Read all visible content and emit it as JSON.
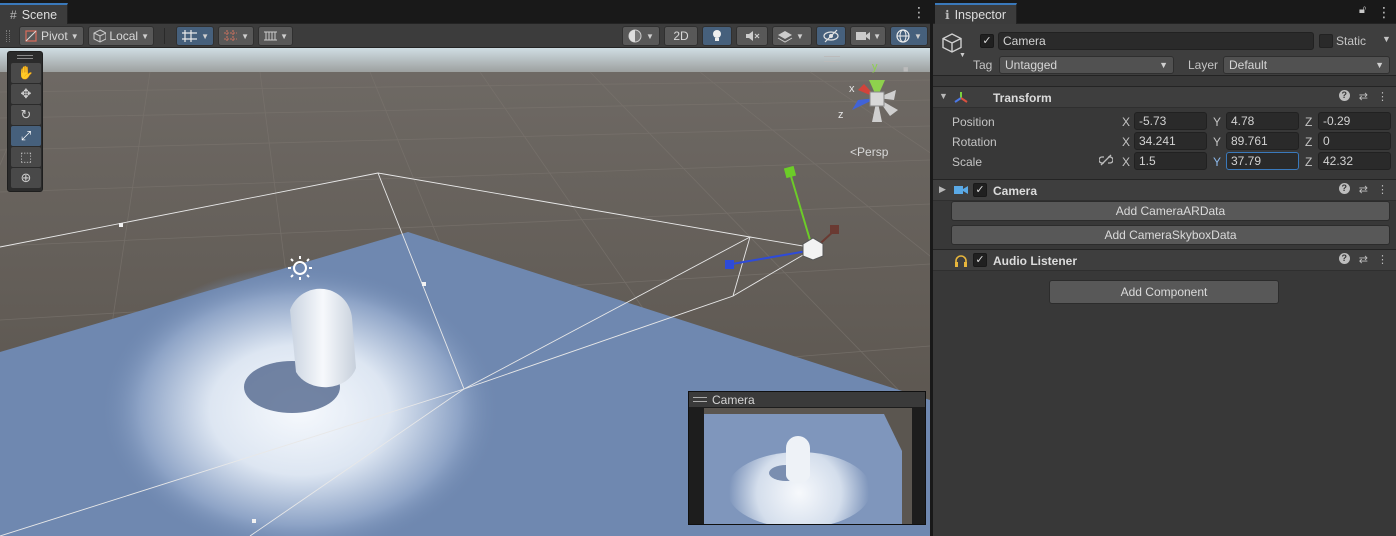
{
  "scene": {
    "tab_title": "Scene",
    "toolbar": {
      "pivot_label": "Pivot",
      "local_label": "Local",
      "mode_2d_label": "2D"
    },
    "persp_label": "Persp",
    "gizmo_axes": {
      "x": "x",
      "y": "y",
      "z": "z"
    },
    "tools": [
      "hand-tool",
      "move-tool",
      "rotate-tool",
      "scale-tool",
      "rect-tool",
      "transform-tool"
    ],
    "active_tool": "scale-tool",
    "camera_preview_title": "Camera"
  },
  "inspector": {
    "tab_title": "Inspector",
    "object": {
      "active": true,
      "name": "Camera",
      "static_label": "Static",
      "tag_label": "Tag",
      "tag_value": "Untagged",
      "layer_label": "Layer",
      "layer_value": "Default"
    },
    "transform": {
      "title": "Transform",
      "position_label": "Position",
      "rotation_label": "Rotation",
      "scale_label": "Scale",
      "axis_x": "X",
      "axis_y": "Y",
      "axis_z": "Z",
      "position": {
        "x": "-5.73",
        "y": "4.78",
        "z": "-0.29"
      },
      "rotation": {
        "x": "34.241",
        "y": "89.761",
        "z": "0"
      },
      "scale": {
        "x": "1.5",
        "y": "37.79",
        "z": "42.32"
      }
    },
    "camera_component": {
      "title": "Camera",
      "enabled": true,
      "buttons": [
        "Add CameraARData",
        "Add CameraSkyboxData"
      ]
    },
    "audio_listener": {
      "title": "Audio Listener",
      "enabled": true
    },
    "add_component_label": "Add Component"
  },
  "colors": {
    "accent": "#3a79bb",
    "panel": "#383838",
    "ground": "#6f88b0",
    "terrain": "#5a5550"
  }
}
